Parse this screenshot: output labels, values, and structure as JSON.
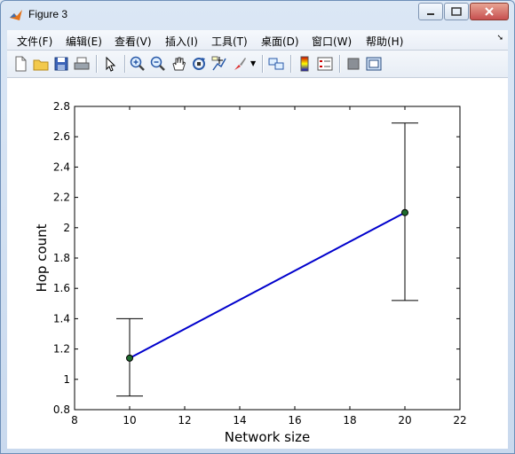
{
  "window": {
    "title": "Figure 3"
  },
  "menu": [
    {
      "label": "文件(F)"
    },
    {
      "label": "编辑(E)"
    },
    {
      "label": "查看(V)"
    },
    {
      "label": "插入(I)"
    },
    {
      "label": "工具(T)"
    },
    {
      "label": "桌面(D)"
    },
    {
      "label": "窗口(W)"
    },
    {
      "label": "帮助(H)"
    }
  ],
  "toolbar": [
    {
      "icon": "new-figure-icon"
    },
    {
      "icon": "open-file-icon"
    },
    {
      "icon": "save-icon"
    },
    {
      "icon": "print-icon"
    },
    {
      "icon": "edit-plot-arrow-icon"
    },
    {
      "icon": "zoom-in-icon"
    },
    {
      "icon": "zoom-out-icon"
    },
    {
      "icon": "pan-hand-icon"
    },
    {
      "icon": "rotate-3d-icon"
    },
    {
      "icon": "data-cursor-icon"
    },
    {
      "icon": "brush-icon"
    },
    {
      "icon": "link-plot-icon"
    },
    {
      "icon": "colorbar-icon"
    },
    {
      "icon": "legend-icon"
    },
    {
      "icon": "hide-plot-tools-icon"
    },
    {
      "icon": "show-plot-tools-icon"
    }
  ],
  "chart_data": {
    "type": "line",
    "x": [
      10,
      20
    ],
    "y": [
      1.14,
      2.1
    ],
    "error_low": [
      0.89,
      1.52
    ],
    "error_high": [
      1.4,
      2.69
    ],
    "xlabel": "Network size",
    "ylabel": "Hop count",
    "xlim": [
      8,
      22
    ],
    "ylim": [
      0.8,
      2.8
    ],
    "xticks": [
      "8",
      "10",
      "12",
      "14",
      "16",
      "18",
      "20",
      "22"
    ],
    "yticks": [
      "0.8",
      "1",
      "1.2",
      "1.4",
      "1.6",
      "1.8",
      "2",
      "2.2",
      "2.4",
      "2.6",
      "2.8"
    ],
    "grid": false,
    "line_color": "#0000cc",
    "marker_color": "#1f6b2e"
  }
}
